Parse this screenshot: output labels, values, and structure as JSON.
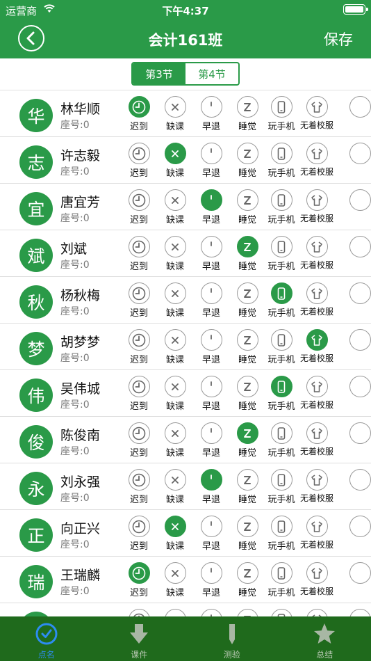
{
  "status_bar": {
    "carrier": "运营商",
    "time": "下午4:37"
  },
  "header": {
    "title": "会计161班",
    "save_label": "保存"
  },
  "segments": [
    {
      "label": "第3节",
      "active": true
    },
    {
      "label": "第4节",
      "active": false
    }
  ],
  "status_labels": [
    "迟到",
    "缺课",
    "早退",
    "睡觉",
    "玩手机",
    "无着校服"
  ],
  "students": [
    {
      "char": "华",
      "name": "林华顺",
      "seat": "座号:0",
      "active": 0
    },
    {
      "char": "志",
      "name": "许志毅",
      "seat": "座号:0",
      "active": 1
    },
    {
      "char": "宜",
      "name": "唐宜芳",
      "seat": "座号:0",
      "active": 2
    },
    {
      "char": "斌",
      "name": "刘斌",
      "seat": "座号:0",
      "active": 3
    },
    {
      "char": "秋",
      "name": "杨秋梅",
      "seat": "座号:0",
      "active": 4
    },
    {
      "char": "梦",
      "name": "胡梦梦",
      "seat": "座号:0",
      "active": 5
    },
    {
      "char": "伟",
      "name": "吴伟城",
      "seat": "座号:0",
      "active": 4
    },
    {
      "char": "俊",
      "name": "陈俊南",
      "seat": "座号:0",
      "active": 3
    },
    {
      "char": "永",
      "name": "刘永强",
      "seat": "座号:0",
      "active": 2
    },
    {
      "char": "正",
      "name": "向正兴",
      "seat": "座号:0",
      "active": 1
    },
    {
      "char": "瑞",
      "name": "王瑞麟",
      "seat": "座号:0",
      "active": 0
    },
    {
      "char": "",
      "name": "",
      "seat": "",
      "active": -1
    }
  ],
  "tabs": [
    {
      "label": "点名",
      "icon": "clock-check-icon",
      "active": true
    },
    {
      "label": "课件",
      "icon": "download-arrow-icon",
      "active": false
    },
    {
      "label": "测验",
      "icon": "pencil-icon",
      "active": false
    },
    {
      "label": "总结",
      "icon": "star-icon",
      "active": false
    }
  ],
  "colors": {
    "primary": "#2a9a48",
    "tabbar": "#1f6a1c",
    "tab_active": "#2d8cf0"
  }
}
